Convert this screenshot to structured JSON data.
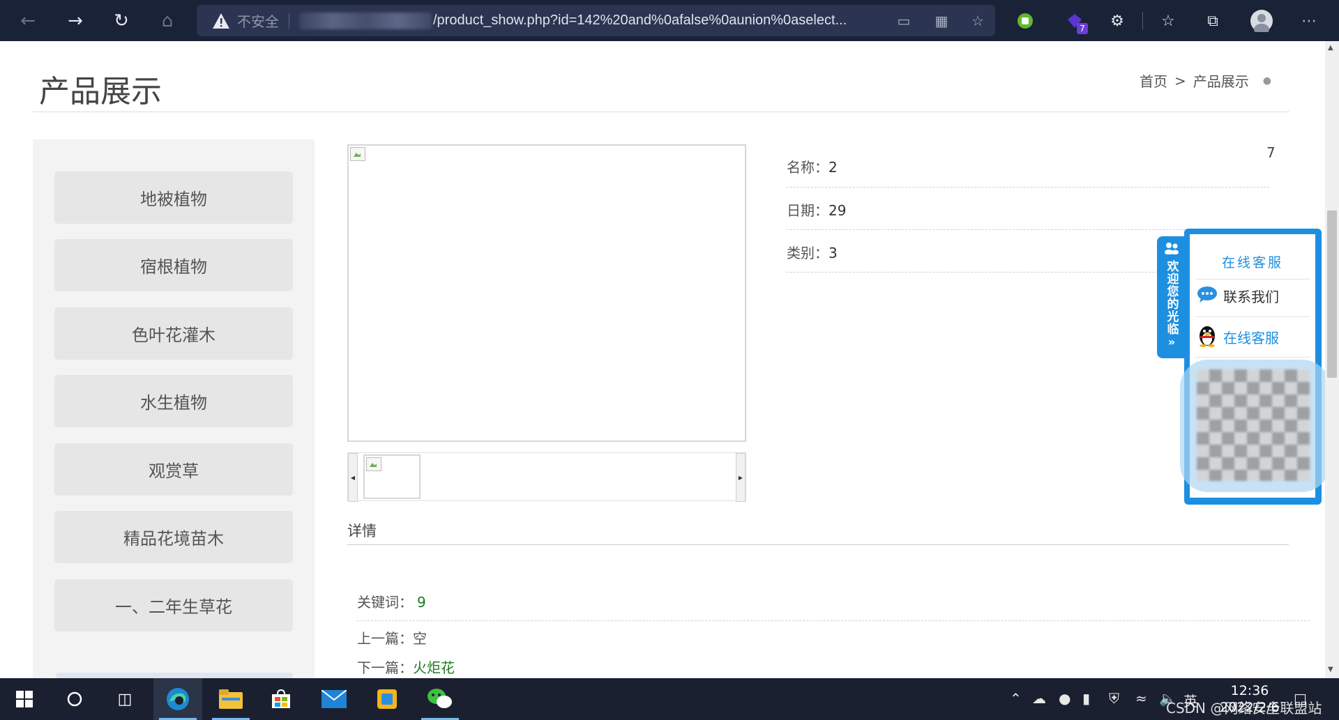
{
  "browser": {
    "security_label": "不安全",
    "url": "/product_show.php?id=142%20and%0afalse%0aunion%0aselect...",
    "extension_badge": "7"
  },
  "page": {
    "title": "产品展示",
    "breadcrumb": [
      "首页",
      ">",
      "产品展示"
    ]
  },
  "sidebar": {
    "categories": [
      "地被植物",
      "宿根植物",
      "色叶花灌木",
      "水生植物",
      "观赏草",
      "精品花境苗木",
      "一、二年生草花"
    ]
  },
  "product": {
    "name_label": "名称：",
    "name_value": "2",
    "date_label": "日期：",
    "date_value": "29",
    "category_label": "类别：",
    "category_value": "3",
    "corner_value": "7",
    "detail_label": "详情",
    "keywords_label": "关键词：",
    "keywords_value": "9",
    "prev_label": "上一篇：",
    "prev_value": "空",
    "next_label": "下一篇：",
    "next_value": "火炬花"
  },
  "service_widget": {
    "tab_text": "欢迎您的光临",
    "header": "在线客服",
    "contact_label": "联系我们",
    "online_label": "在线客服"
  },
  "taskbar": {
    "ime": "英",
    "time": "12:36",
    "date": "2022/2/6",
    "watermark": "CSDN @网络安全联盟站"
  }
}
